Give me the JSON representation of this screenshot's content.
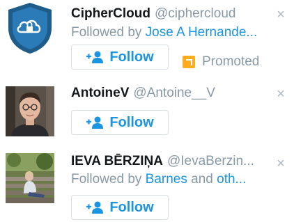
{
  "suggestions": [
    {
      "display_name": "CipherCloud",
      "handle": "@ciphercloud",
      "followed_prefix": "Followed by ",
      "followed_names": "Jose A Hernande...",
      "follow_label": "Follow",
      "promoted_label": "Promoted",
      "dismiss": "×"
    },
    {
      "display_name": "AntoineV",
      "handle": "@Antoine__V",
      "follow_label": "Follow",
      "dismiss": "×"
    },
    {
      "display_name": "IEVA BĒRZIŅA",
      "handle": "@IevaBerzin...",
      "followed_prefix": "Followed by ",
      "followed_names_1": "Barnes",
      "followed_and": " and ",
      "followed_names_2": "oth...",
      "follow_label": "Follow",
      "dismiss": "×"
    }
  ],
  "colors": {
    "accent": "#1b95e0",
    "muted": "#8899a6",
    "promoted_badge": "#ffad1f",
    "shield": "#1e5c8a"
  }
}
